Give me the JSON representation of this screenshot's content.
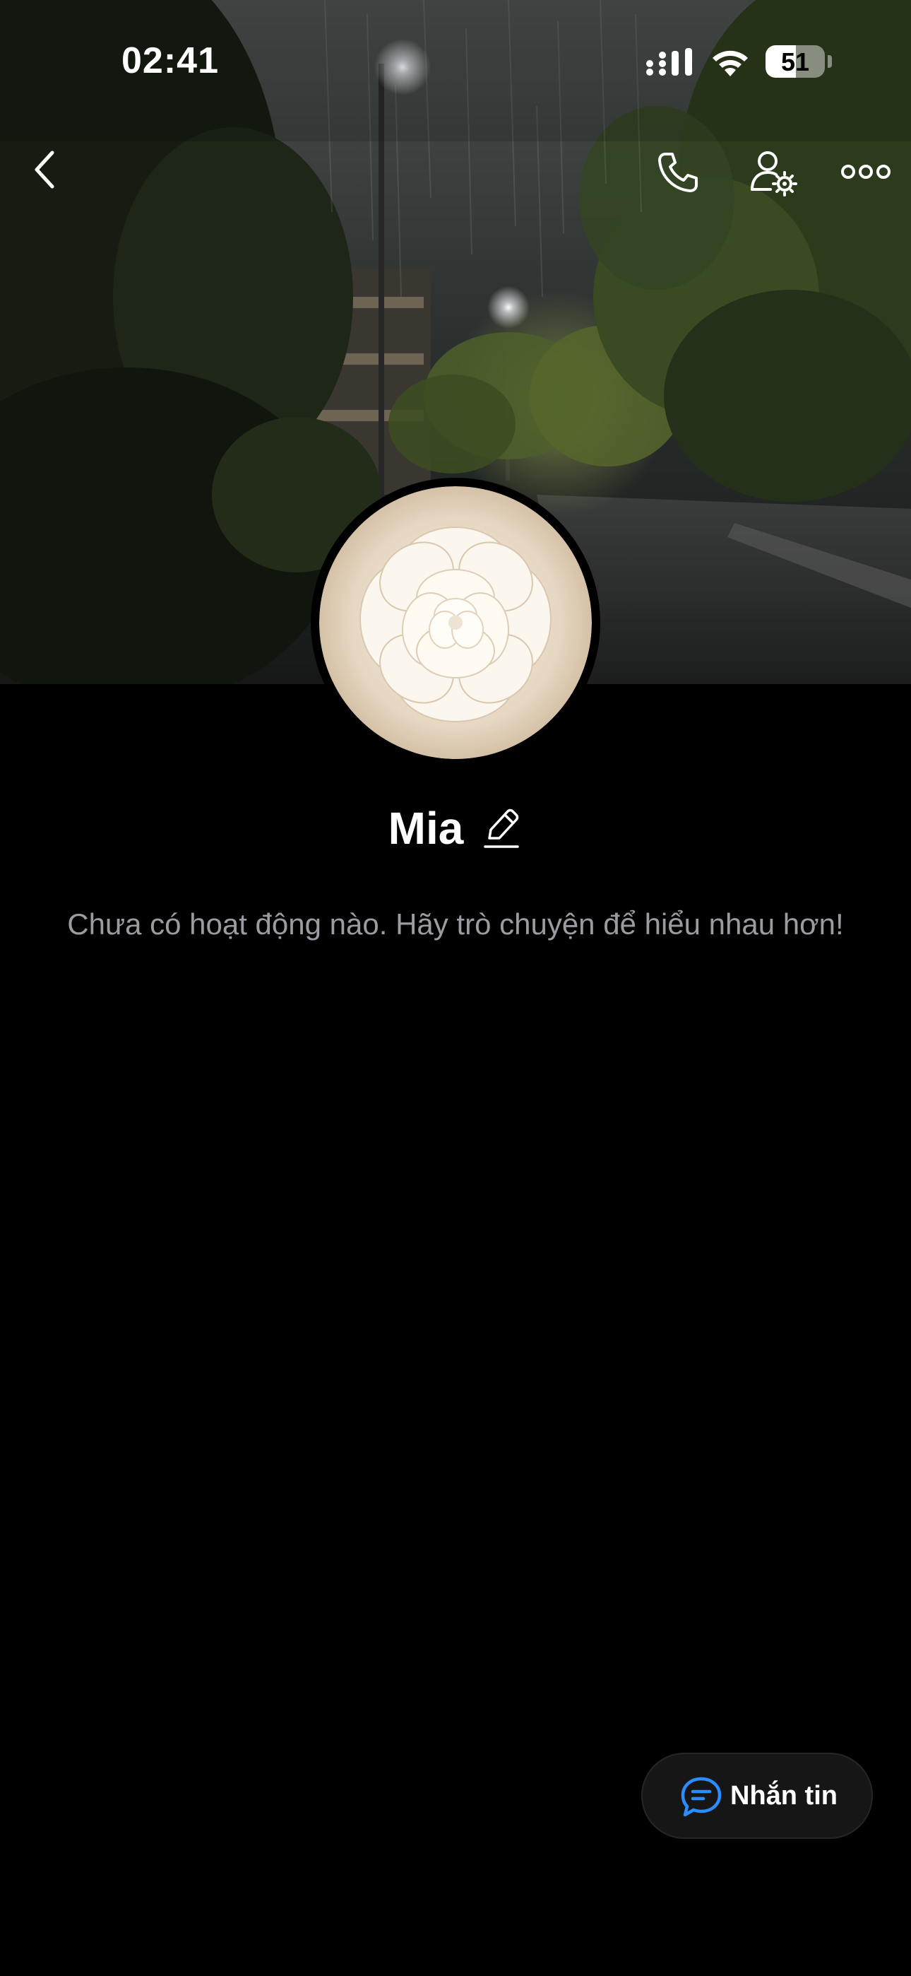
{
  "status_bar": {
    "time": "02:41",
    "battery_level": "51"
  },
  "nav": {
    "back_icon": "chevron-left-icon",
    "call_icon": "phone-icon",
    "user_settings_icon": "user-gear-icon",
    "more_icon": "ellipsis-icon"
  },
  "profile": {
    "name": "Mia",
    "empty_activity_text": "Chưa có hoạt động nào. Hãy trò chuyện để hiểu nhau hơn!"
  },
  "actions": {
    "message_label": "Nhắn tin",
    "message_icon": "chat-bubble-icon"
  },
  "colors": {
    "background": "#000000",
    "message_icon_accent": "#2b8cff",
    "muted_text": "#9a9ca2"
  }
}
